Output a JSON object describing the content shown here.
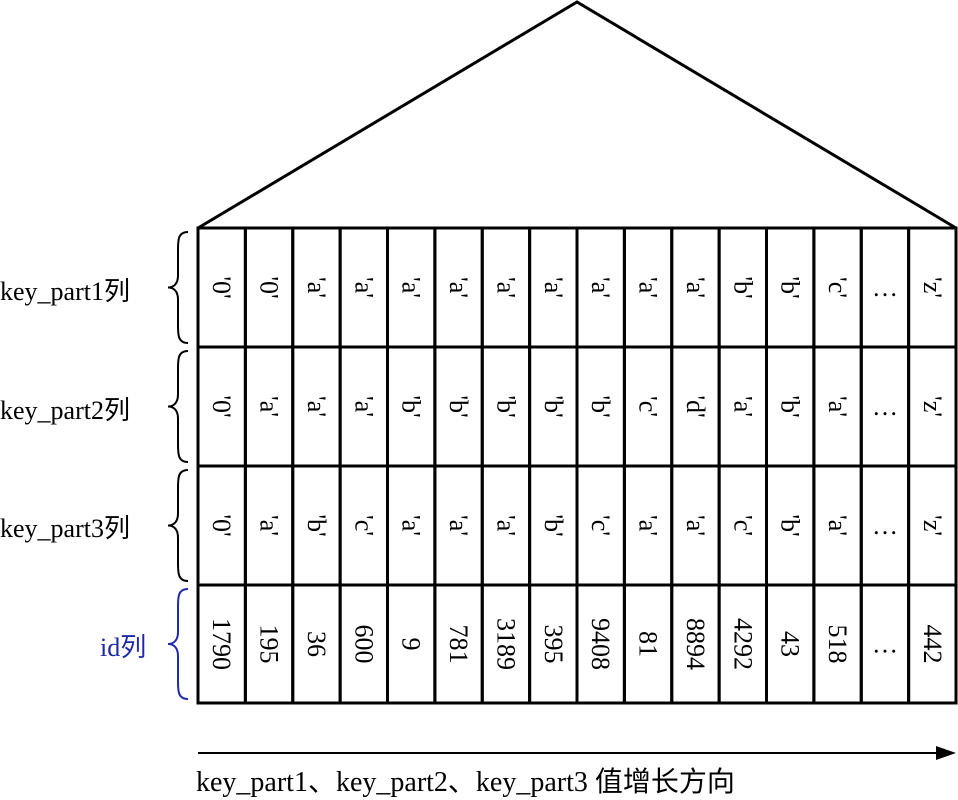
{
  "rows": [
    {
      "label": "key_part1列",
      "color": "#000000",
      "cells": [
        "'0'",
        "'0'",
        "'a'",
        "'a'",
        "'a'",
        "'a'",
        "'a'",
        "'a'",
        "'a'",
        "'a'",
        "'a'",
        "'b'",
        "'b'",
        "'c'",
        "…",
        "'z'"
      ]
    },
    {
      "label": "key_part2列",
      "color": "#000000",
      "cells": [
        "'0'",
        "'a'",
        "'a'",
        "'a'",
        "'b'",
        "'b'",
        "'b'",
        "'b'",
        "'b'",
        "'c'",
        "'d'",
        "'a'",
        "'b'",
        "'a'",
        "…",
        "'z'"
      ]
    },
    {
      "label": "key_part3列",
      "color": "#000000",
      "cells": [
        "'0'",
        "'a'",
        "'b'",
        "'c'",
        "'a'",
        "'a'",
        "'a'",
        "'b'",
        "'c'",
        "'a'",
        "'a'",
        "'c'",
        "'b'",
        "'a'",
        "…",
        "'z'"
      ]
    },
    {
      "label": "id列",
      "color": "#1f2aa8",
      "cells": [
        "1790",
        "195",
        "36",
        "600",
        "9",
        "781",
        "3189",
        "395",
        "9408",
        "81",
        "8894",
        "4292",
        "43",
        "518",
        "…",
        "442"
      ]
    }
  ],
  "caption": "key_part1、key_part2、key_part3 值增长方向"
}
